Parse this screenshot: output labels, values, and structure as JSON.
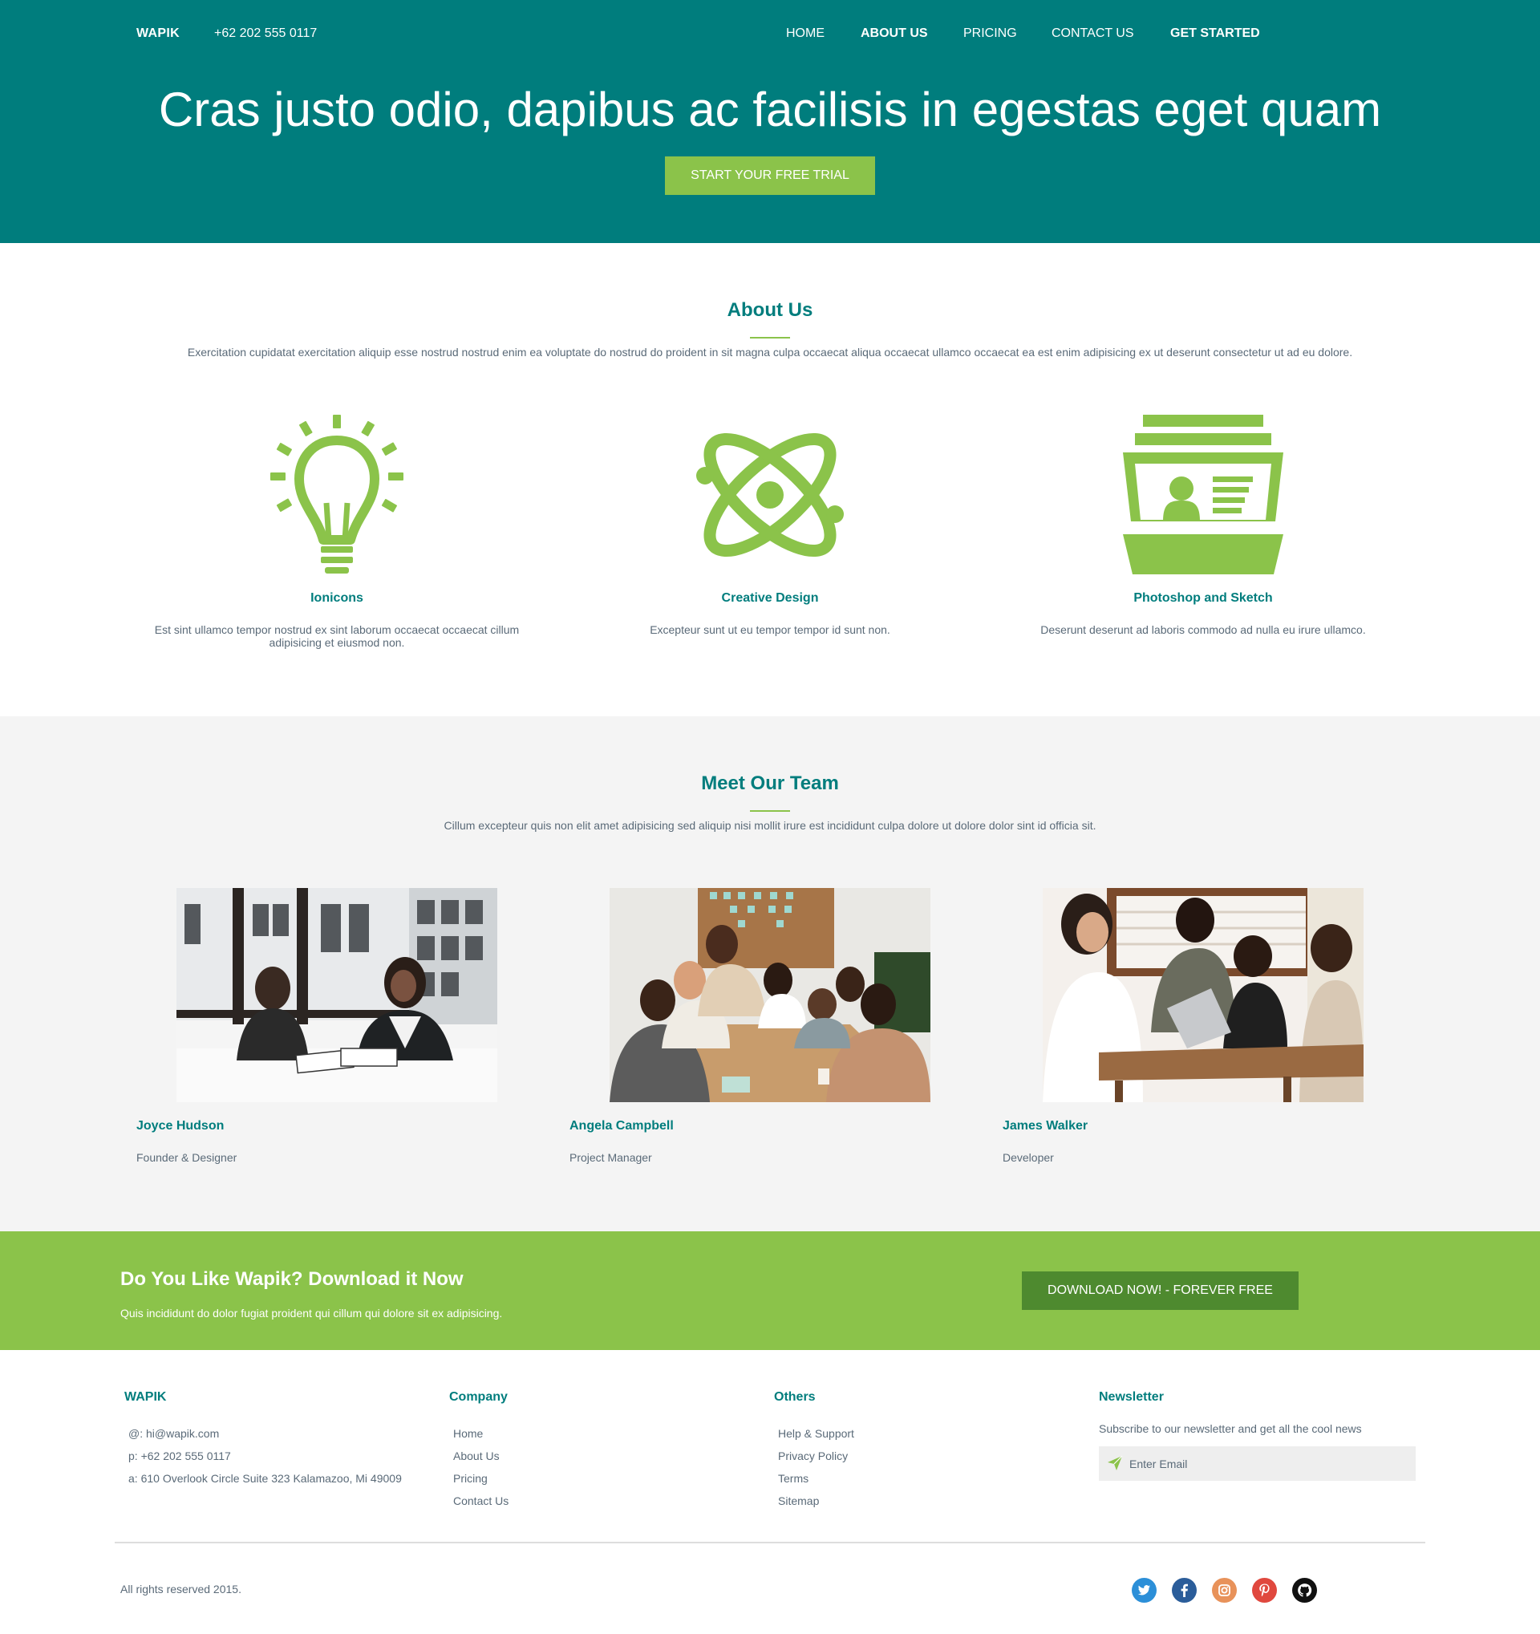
{
  "header": {
    "brand": "WAPIK",
    "phone": "+62 202 555 0117",
    "nav": [
      "HOME",
      "ABOUT US",
      "PRICING",
      "CONTACT US",
      "GET STARTED"
    ],
    "active_nav": "ABOUT US"
  },
  "hero": {
    "title": "Cras justo odio, dapibus ac facilisis in egestas eget quam",
    "button": "START YOUR FREE TRIAL"
  },
  "about": {
    "title": "About Us",
    "desc": "Exercitation cupidatat exercitation aliquip esse nostrud nostrud enim ea voluptate do nostrud do proident in sit magna culpa occaecat aliqua occaecat ullamco occaecat ea est enim adipisicing ex ut deserunt consectetur ut ad eu dolore.",
    "features": [
      {
        "icon": "lightbulb-icon",
        "title": "Ionicons",
        "desc": "Est sint ullamco tempor nostrud ex sint laborum occaecat occaecat cillum adipisicing et eiusmod non."
      },
      {
        "icon": "atom-icon",
        "title": "Creative Design",
        "desc": "Excepteur sunt ut eu tempor tempor id sunt non."
      },
      {
        "icon": "id-card-icon",
        "title": "Photoshop and Sketch",
        "desc": "Deserunt deserunt ad laboris commodo ad nulla eu irure ullamco."
      }
    ]
  },
  "team": {
    "title": "Meet Our Team",
    "desc": "Cillum excepteur quis non elit amet adipisicing sed aliquip nisi mollit irure est incididunt culpa dolore ut dolore dolor sint id officia sit.",
    "members": [
      {
        "name": "Joyce Hudson",
        "role": "Founder & Designer"
      },
      {
        "name": "Angela Campbell",
        "role": "Project Manager"
      },
      {
        "name": "James Walker",
        "role": "Developer"
      }
    ]
  },
  "cta": {
    "title": "Do You Like Wapik? Download it Now",
    "desc": "Quis incididunt do dolor fugiat proident qui cillum qui dolore sit ex adipisicing.",
    "button": "DOWNLOAD NOW! - FOREVER FREE"
  },
  "footer": {
    "col1": {
      "title": "WAPIK",
      "lines": [
        "@: hi@wapik.com",
        "p: +62 202 555 0117",
        "a: 610 Overlook Circle Suite 323 Kalamazoo, Mi 49009"
      ]
    },
    "company": {
      "title": "Company",
      "links": [
        "Home",
        "About Us",
        "Pricing",
        "Contact Us"
      ]
    },
    "others": {
      "title": "Others",
      "links": [
        "Help & Support",
        "Privacy Policy",
        "Terms",
        "Sitemap"
      ]
    },
    "newsletter": {
      "title": "Newsletter",
      "desc": "Subscribe to our newsletter and get all the cool news",
      "placeholder": "Enter Email"
    },
    "copyright": "All rights reserved 2015.",
    "social": [
      "twitter-icon",
      "facebook-icon",
      "instagram-icon",
      "pinterest-icon",
      "github-icon"
    ]
  },
  "colors": {
    "primary": "#007d7d",
    "accent": "#8bc34a",
    "cta_button": "#4e8a2f",
    "text": "#5a6a78",
    "team_bg": "#f4f4f4"
  }
}
